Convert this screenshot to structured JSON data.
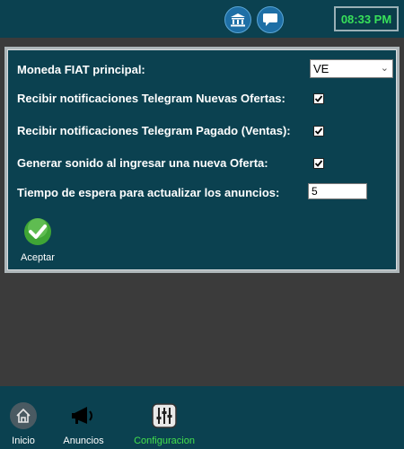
{
  "topbar": {
    "bank_icon": "bank-icon",
    "chat_icon": "chat-icon",
    "clock": "08:33 PM"
  },
  "settings": {
    "fiat_label": "Moneda FIAT principal:",
    "fiat_value": "VE",
    "notif_new_label": "Recibir notificaciones Telegram Nuevas Ofertas:",
    "notif_new_checked": true,
    "notif_paid_label": "Recibir notificaciones Telegram Pagado (Ventas):",
    "notif_paid_checked": true,
    "sound_label": "Generar sonido al ingresar una nueva Oferta:",
    "sound_checked": true,
    "wait_label": "Tiempo de espera para actualizar los anuncios:",
    "wait_value": "5",
    "accept_label": "Aceptar"
  },
  "nav": {
    "items": [
      {
        "label": "Inicio",
        "icon": "home-icon"
      },
      {
        "label": "Anuncios",
        "icon": "megaphone-icon"
      },
      {
        "label": "Configuracion",
        "icon": "sliders-icon",
        "active": true
      }
    ]
  },
  "colors": {
    "panel": "#0b4150",
    "clock_text": "#38e05a",
    "active_nav": "#43e04d",
    "background": "#3b3b3b"
  }
}
